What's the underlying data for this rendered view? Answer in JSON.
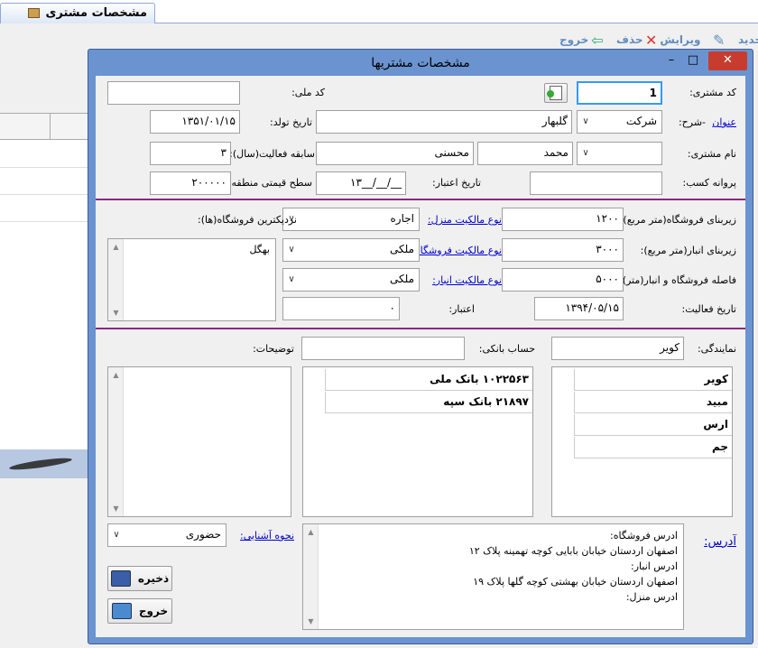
{
  "background_app": {
    "tab_title": "مشخصات مشتری",
    "toolbar": {
      "new": "جدید",
      "edit": "ویرایش",
      "delete": "حذف",
      "exit": "خروج"
    }
  },
  "dialog": {
    "title": "مشخصات مشتریها",
    "title_buttons": {
      "minimize": "–",
      "maximize": "□",
      "close": "✕"
    },
    "customer_code": {
      "label": "کد مشتری:",
      "value": "1"
    },
    "national_code": {
      "label": "کد ملی:",
      "value": ""
    },
    "title_row": {
      "link": "عنوان",
      "label": "-شرح:",
      "title_select": "شرکت",
      "description": "گلبهار"
    },
    "birth_date": {
      "label": "تاریخ تولد:",
      "value": "۱۳۵۱/۰۱/۱۵"
    },
    "customer_name": {
      "label": "نام مشتری:",
      "first_name": "محمد",
      "last_name": "محسنی"
    },
    "work_experience": {
      "label": "سابقه فعالیت(سال):",
      "value": "۳"
    },
    "license": {
      "label": "پروانه کسب:",
      "value": ""
    },
    "credit_date": {
      "label": "تاریخ اعتبار:",
      "value": "۱۳__/__/__"
    },
    "price_level": {
      "label": "سطح قیمتی منطقه:",
      "value": "۲۰۰۰۰۰"
    },
    "store_area": {
      "label": "زیربنای فروشگاه(متر مربع):",
      "value": "۱۲۰۰"
    },
    "home_ownership": {
      "link": "نوع مالکیت منزل:",
      "value": "اجاره"
    },
    "nearest_stores": {
      "label": "نزدیکترین فروشگاه(ها):",
      "items": [
        "بهگل"
      ]
    },
    "warehouse_area": {
      "label": "زیربنای انبار(متر مربع):",
      "value": "۳۰۰۰"
    },
    "store_ownership": {
      "link": "نوع مالکیت فروشگاه:",
      "value": "ملکی"
    },
    "distance": {
      "label": "فاصله فروشگاه و انبار(متر):",
      "value": "۵۰۰۰"
    },
    "warehouse_ownership": {
      "link": "نوع مالکیت انبار:",
      "value": "ملکی"
    },
    "activity_date": {
      "label": "تاریخ فعالیت:",
      "value": "۱۳۹۴/۰۵/۱۵"
    },
    "credit": {
      "label": "اعتبار:",
      "value": "۰"
    },
    "agency": {
      "label": "نمایندگی:",
      "value": "کویر",
      "items": [
        "کویر",
        "مبید",
        "ارس",
        "جم"
      ]
    },
    "bank_account": {
      "label": "حساب بانکی:",
      "value": "",
      "items": [
        "۱۰۲۲۵۶۳ بانک ملی",
        "۲۱۸۹۷ بانک سپه"
      ]
    },
    "notes": {
      "label": "توضیحات:",
      "value": ""
    },
    "address": {
      "link": "آدرس:",
      "lines": [
        "ادرس فروشگاه:",
        "اصفهان اردستان خیابان بابایی کوچه تهمینه پلاک ۱۲",
        "ادرس انبار:",
        "اصفهان اردستان خیابان بهشتی کوچه گلها پلاک ۱۹",
        "ادرس منزل:"
      ]
    },
    "acquaintance": {
      "link": "نحوه آشنایی:",
      "value": "حضوری"
    },
    "save_button": "ذخیره",
    "exit_button": "خروج"
  }
}
